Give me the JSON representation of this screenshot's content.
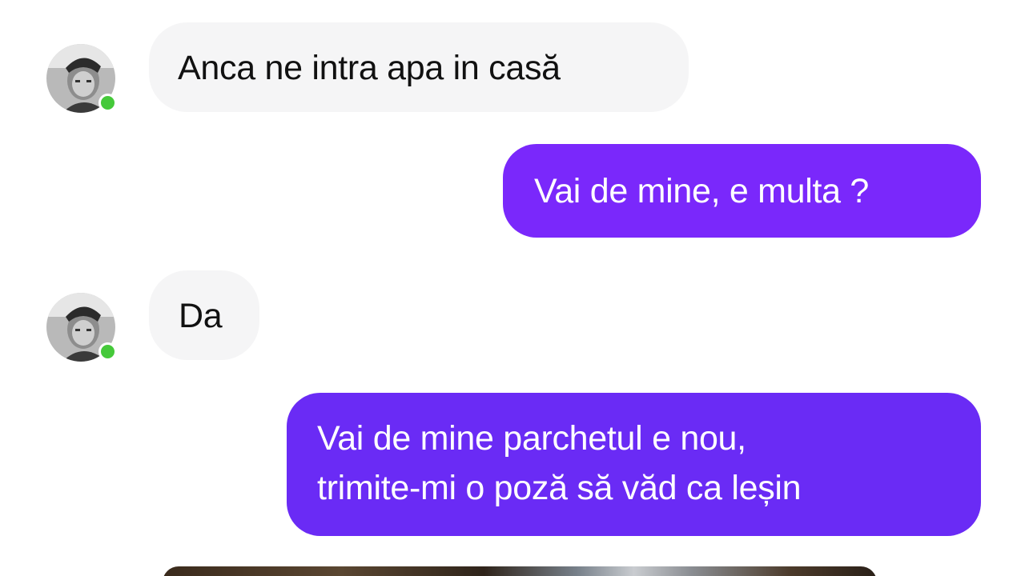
{
  "colors": {
    "incoming_bubble": "#f5f5f6",
    "outgoing_bubble_1": "#7a28fb",
    "outgoing_bubble_2": "#6a2bf5",
    "online_indicator": "#45c93a"
  },
  "messages": [
    {
      "direction": "incoming",
      "lines": [
        "Anca ne intra apa in casă"
      ]
    },
    {
      "direction": "outgoing",
      "lines": [
        "Vai de mine, e multa ?"
      ]
    },
    {
      "direction": "incoming",
      "lines": [
        "Da"
      ]
    },
    {
      "direction": "outgoing",
      "lines": [
        "Vai de mine parchetul e nou,",
        "trimite-mi o poză să văd ca leșin"
      ]
    }
  ],
  "attachment": {
    "type": "photo",
    "icon": "image-preview"
  }
}
